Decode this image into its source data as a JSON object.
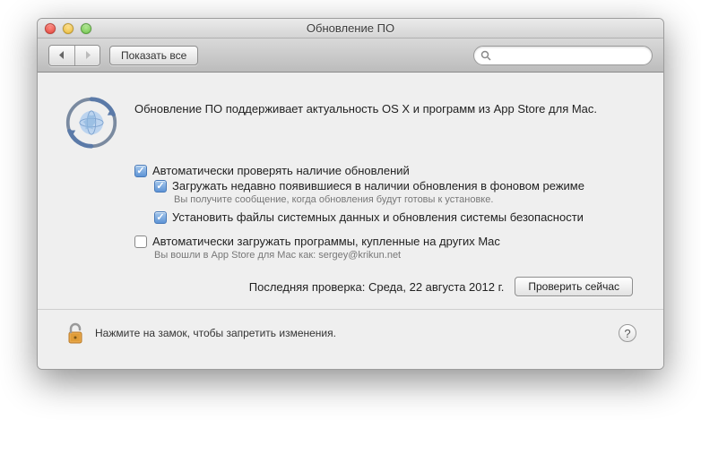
{
  "window": {
    "title": "Обновление ПО"
  },
  "toolbar": {
    "show_all_label": "Показать все",
    "search_placeholder": ""
  },
  "intro": {
    "text": "Обновление ПО поддерживает актуальность OS X и программ из App Store для Mac."
  },
  "options": {
    "auto_check": {
      "label": "Автоматически проверять наличие обновлений",
      "checked": true
    },
    "download_bg": {
      "label": "Загружать недавно появившиеся в наличии обновления в фоновом режиме",
      "subtext": "Вы получите сообщение, когда обновления будут готовы к установке.",
      "checked": true
    },
    "install_system": {
      "label": "Установить файлы системных данных и обновления системы безопасности",
      "checked": true
    },
    "auto_download_apps": {
      "label": "Автоматически загружать программы, купленные на других Mac",
      "subtext": "Вы вошли в App Store для Mac как: sergey@krikun.net",
      "checked": false
    }
  },
  "last_check": {
    "prefix": "Последняя проверка:",
    "value": "Среда, 22 августа 2012 г.",
    "button": "Проверить сейчас"
  },
  "footer": {
    "lock_text": "Нажмите на замок, чтобы запретить изменения.",
    "help": "?"
  }
}
